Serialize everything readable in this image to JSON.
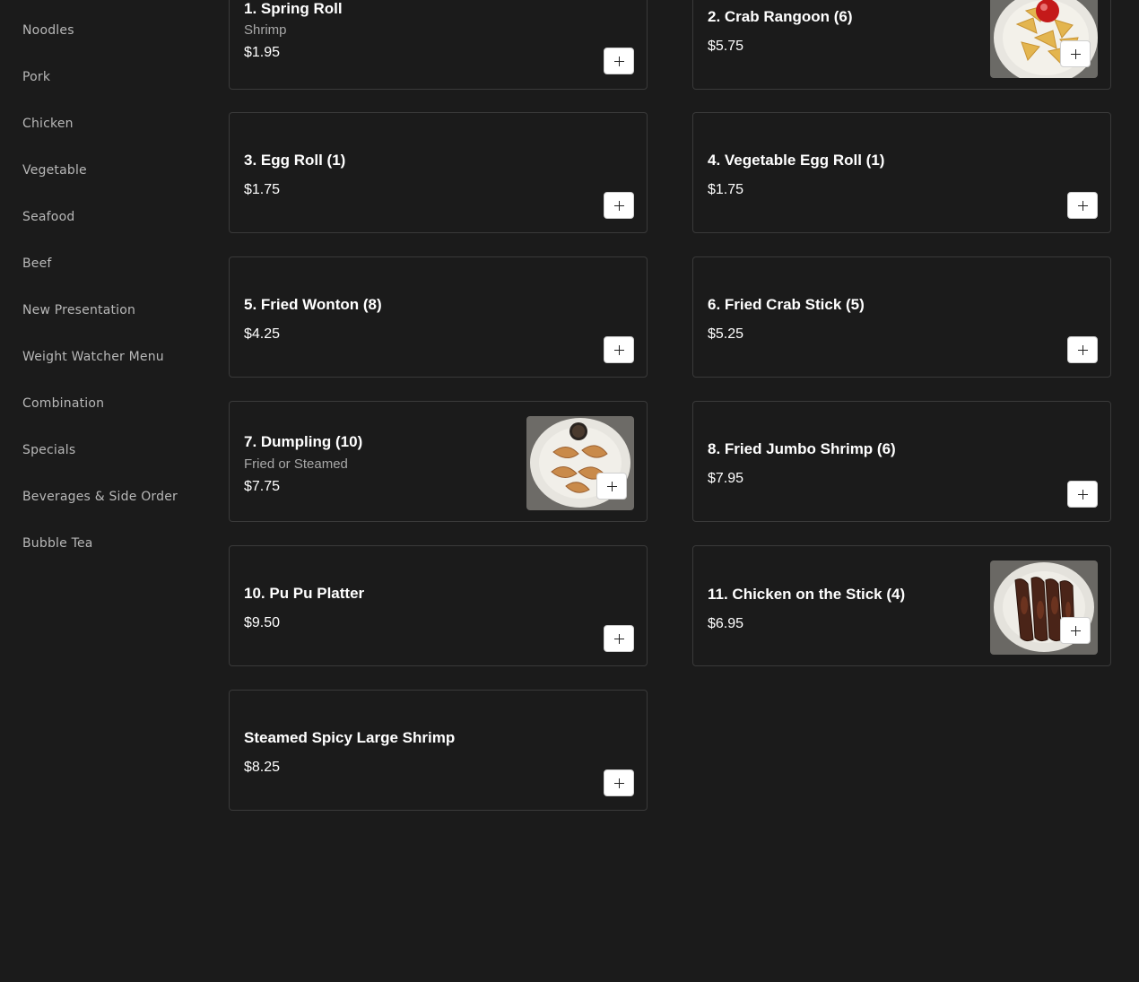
{
  "sidebar": {
    "items": [
      {
        "label": "Noodles"
      },
      {
        "label": "Pork"
      },
      {
        "label": "Chicken"
      },
      {
        "label": "Vegetable"
      },
      {
        "label": "Seafood"
      },
      {
        "label": "Beef"
      },
      {
        "label": "New Presentation"
      },
      {
        "label": "Weight Watcher Menu"
      },
      {
        "label": "Combination"
      },
      {
        "label": "Specials"
      },
      {
        "label": "Beverages & Side Order"
      },
      {
        "label": "Bubble Tea"
      }
    ]
  },
  "menu": {
    "items": [
      {
        "title": "1. Spring Roll",
        "description": "Shrimp",
        "price": "$1.95"
      },
      {
        "title": "2. Crab Rangoon (6)",
        "price": "$5.75",
        "image": "crab-rangoon-photo"
      },
      {
        "title": "3. Egg Roll (1)",
        "price": "$1.75"
      },
      {
        "title": "4. Vegetable Egg Roll (1)",
        "price": "$1.75"
      },
      {
        "title": "5. Fried Wonton (8)",
        "price": "$4.25"
      },
      {
        "title": "6. Fried Crab Stick (5)",
        "price": "$5.25"
      },
      {
        "title": "7. Dumpling (10)",
        "description": "Fried or Steamed",
        "price": "$7.75",
        "image": "dumpling-photo"
      },
      {
        "title": "8. Fried Jumbo Shrimp (6)",
        "price": "$7.95"
      },
      {
        "title": "10. Pu Pu Platter",
        "price": "$9.50"
      },
      {
        "title": "11. Chicken on the Stick (4)",
        "price": "$6.95",
        "image": "chicken-stick-photo"
      },
      {
        "title": "Steamed Spicy Large Shrimp",
        "price": "$8.25"
      }
    ],
    "add_button_icon": "plus-icon"
  },
  "colors": {
    "background": "#1b1b1b",
    "card_border": "#3a3a3a",
    "sidebar_text": "#b8b8b8",
    "title_text": "#ffffff",
    "description_text": "#a8a8a8"
  }
}
